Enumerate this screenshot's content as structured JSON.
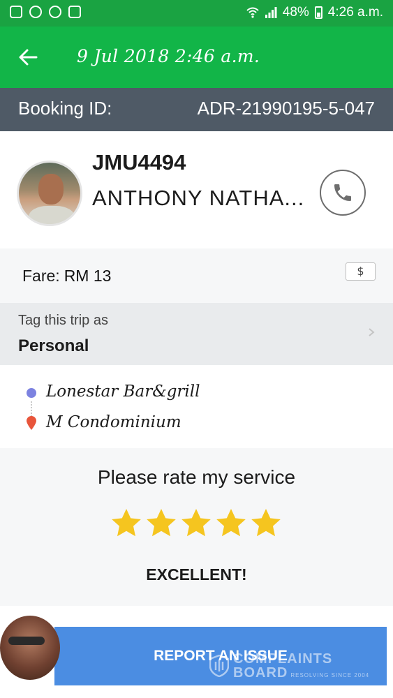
{
  "status_bar": {
    "battery": "48%",
    "time": "4:26 a.m."
  },
  "app_bar": {
    "title": "9 Jul 2018 2:46 a.m."
  },
  "booking": {
    "label": "Booking ID:",
    "id": "ADR-21990195-5-047"
  },
  "driver": {
    "plate": "JMU4494",
    "name": "ANTHONY NATHA..."
  },
  "fare": {
    "label": "Fare:",
    "amount": "RM 13",
    "currency_badge": "$"
  },
  "tag": {
    "label": "Tag this trip as",
    "value": "Personal"
  },
  "route": {
    "pickup": "Lonestar Bar&grill",
    "dropoff": "M Condominium"
  },
  "rating": {
    "prompt": "Please rate my service",
    "stars": 5,
    "max_stars": 5,
    "result": "EXCELLENT!",
    "star_color": "#f5c51f"
  },
  "report": {
    "label": "REPORT AN ISSUE"
  },
  "watermark": {
    "line1": "COMPLAINTS",
    "line2": "BOARD",
    "tagline": "RESOLVING SINCE 2004"
  },
  "colors": {
    "status_bar": "#1aa342",
    "app_bar": "#12b548",
    "booking_bar": "#4f5a66",
    "report_button": "#4b8de2",
    "pickup_dot": "#7c82e0",
    "dropoff_pin": "#e8553b"
  }
}
